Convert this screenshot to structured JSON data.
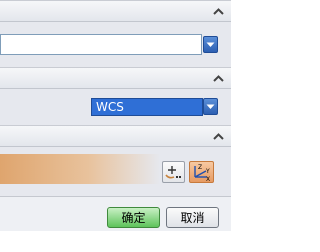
{
  "section2": {
    "coordinate_system_value": "WCS"
  },
  "footer": {
    "ok_label": "确定",
    "cancel_label": "取消"
  },
  "icons": {
    "collapse": "chevron-up-icon",
    "dropdown": "chevron-down-icon",
    "point_dialog": "point-dialog-icon",
    "csys": "coordinate-system-icon"
  },
  "colors": {
    "accent_blue": "#2f6fd6",
    "ok_green": "#5ec35b",
    "gradient_orange": "#dfa56e"
  }
}
